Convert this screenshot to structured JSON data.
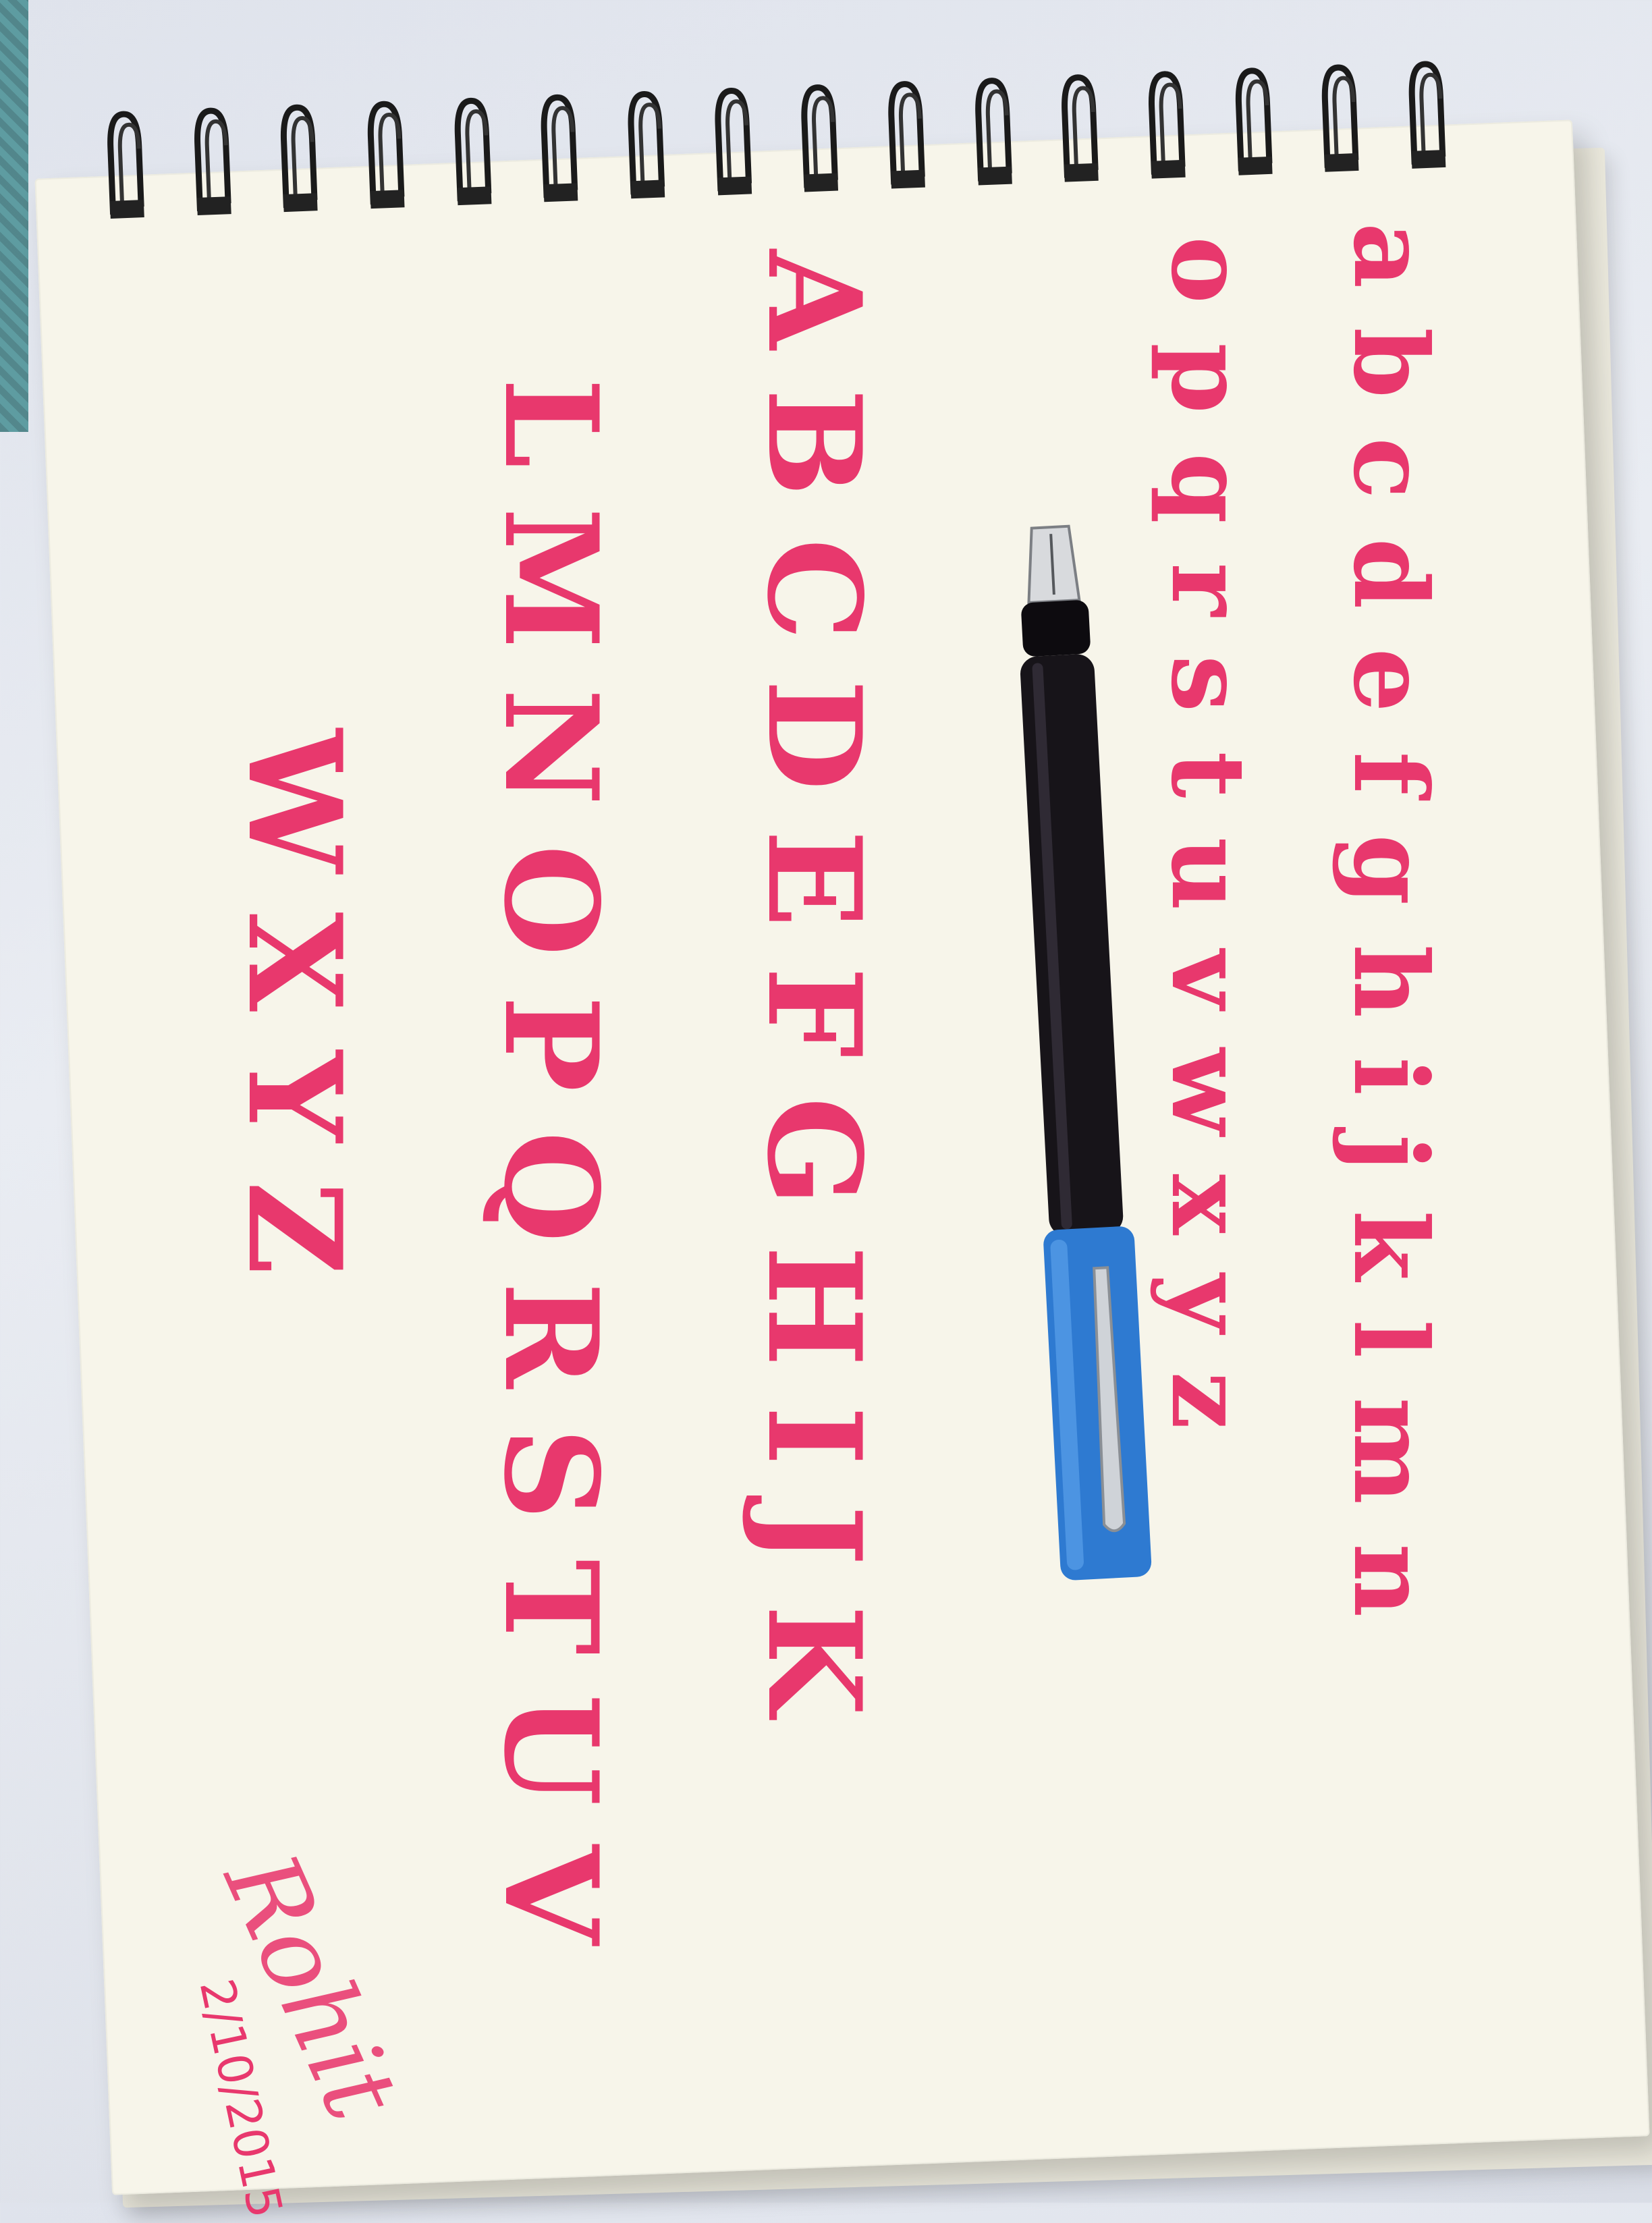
{
  "photo": {
    "subject": "pen",
    "colors": {
      "ink": "#e8386d",
      "paper": "#f7f5ea",
      "pen_barrel": "#151316",
      "pen_cap": "#2e7ad1",
      "clip": "#cfd3d8"
    }
  },
  "sheet": {
    "lowercase_line_1": "abcdefghijklmn",
    "lowercase_line_2": "opqrstuvwxyz",
    "uppercase_line_1": "ABCDEFGHIJK",
    "uppercase_line_2": "LMNOPQRSTUV",
    "uppercase_line_3": "WXYZ",
    "signature": "Rohit",
    "date": "2/10/2015"
  }
}
